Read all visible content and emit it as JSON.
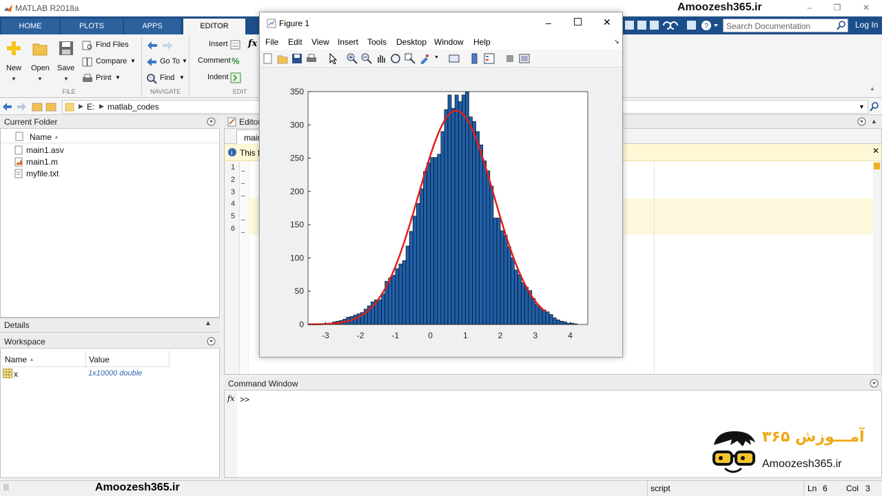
{
  "app": {
    "title": "MATLAB R2018a",
    "watermark": "Amoozesh365.ir"
  },
  "tabs": [
    "HOME",
    "PLOTS",
    "APPS",
    "EDITOR"
  ],
  "search": {
    "placeholder": "Search Documentation"
  },
  "login": "Log In",
  "ribbon": {
    "new": "New",
    "open": "Open",
    "save": "Save",
    "find_files": "Find Files",
    "compare": "Compare",
    "print": "Print",
    "goto": "Go To",
    "find": "Find",
    "insert": "Insert",
    "comment": "Comment",
    "indent": "Indent",
    "fx": "fx",
    "sections": {
      "file": "FILE",
      "navigate": "NAVIGATE",
      "edit": "EDIT"
    }
  },
  "address": {
    "drive": "E:",
    "folder": "matlab_codes"
  },
  "current_folder": {
    "title": "Current Folder",
    "column": "Name",
    "files": [
      "main1.asv",
      "main1.m",
      "myfile.txt"
    ]
  },
  "details": {
    "title": "Details"
  },
  "workspace": {
    "title": "Workspace",
    "columns": [
      "Name",
      "Value"
    ],
    "rows": [
      {
        "name": "x",
        "value": "1x10000 double"
      }
    ]
  },
  "editor": {
    "title": "Editor",
    "tab": "main",
    "info": "This fi",
    "line_numbers": [
      "1",
      "2",
      "3",
      "4",
      "5",
      "6"
    ]
  },
  "command_window": {
    "title": "Command Window",
    "prompt": ">>",
    "fx": "fx"
  },
  "figure": {
    "title": "Figure 1",
    "menu": [
      "File",
      "Edit",
      "View",
      "Insert",
      "Tools",
      "Desktop",
      "Window",
      "Help"
    ]
  },
  "chart_data": {
    "type": "bar",
    "title": "",
    "xlabel": "",
    "ylabel": "",
    "xlim": [
      -3.5,
      4.5
    ],
    "ylim": [
      0,
      350
    ],
    "xticks": [
      -3,
      -2,
      -1,
      0,
      1,
      2,
      3,
      4
    ],
    "yticks": [
      0,
      50,
      100,
      150,
      200,
      250,
      300,
      350
    ],
    "bin_start": -3.5,
    "bin_width": 0.1,
    "bar_color": "#1f5fa8",
    "fit_color": "#e0201a",
    "values": [
      0,
      0,
      1,
      1,
      1,
      1,
      2,
      4,
      5,
      6,
      8,
      11,
      12,
      14,
      16,
      18,
      23,
      28,
      34,
      37,
      37,
      46,
      65,
      70,
      74,
      84,
      91,
      96,
      118,
      140,
      163,
      182,
      204,
      230,
      243,
      251,
      251,
      256,
      290,
      323,
      345,
      325,
      345,
      335,
      345,
      350,
      312,
      305,
      290,
      270,
      246,
      231,
      208,
      160,
      160,
      141,
      134,
      117,
      100,
      82,
      75,
      63,
      56,
      51,
      39,
      30,
      25,
      22,
      19,
      15,
      10,
      7,
      5,
      4,
      2,
      2,
      1,
      0,
      0,
      0,
      0,
      0,
      0,
      0,
      0,
      0,
      0,
      0,
      0,
      0
    ]
  },
  "status": {
    "mode": "script",
    "ln_label": "Ln",
    "ln": "6",
    "col_label": "Col",
    "col": "3"
  },
  "logo": {
    "persian": "آمـــوزش ۳۶۵",
    "site": "Amoozesh365.ir"
  }
}
